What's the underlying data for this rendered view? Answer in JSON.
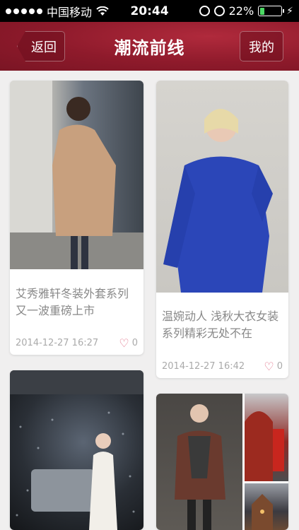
{
  "status_bar": {
    "carrier": "中国移动",
    "time": "20:44",
    "battery": "22%",
    "battery_level": 0.22,
    "battery_color": "#4cd964"
  },
  "nav": {
    "back_label": "返回",
    "title": "潮流前线",
    "mine_label": "我的",
    "bar_color": "#8e1a2b"
  },
  "cards": [
    {
      "title": "艾秀雅轩冬装外套系列又一波重磅上市",
      "date": "2014-12-27 16:27",
      "likes": "0"
    },
    {
      "title": "温婉动人 浅秋大衣女装系列精彩无处不在",
      "date": "2014-12-27 16:42",
      "likes": "0"
    },
    {
      "title": "",
      "date": "",
      "likes": ""
    },
    {
      "title": "",
      "date": "",
      "likes": ""
    }
  ]
}
